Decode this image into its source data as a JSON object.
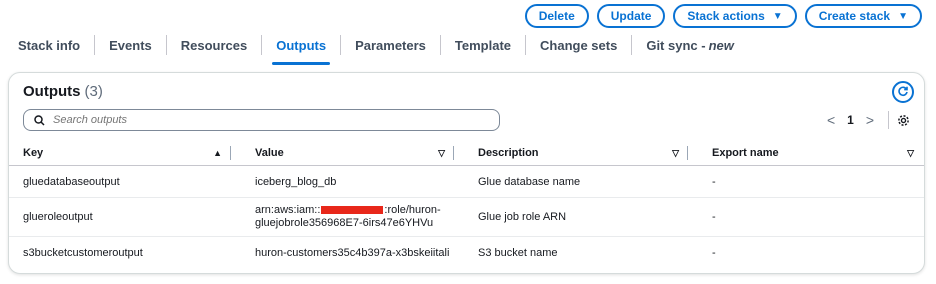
{
  "actions": {
    "delete": "Delete",
    "update": "Update",
    "stack_actions": "Stack actions",
    "create_stack": "Create stack"
  },
  "tabs": [
    {
      "label": "Stack info"
    },
    {
      "label": "Events"
    },
    {
      "label": "Resources"
    },
    {
      "label": "Outputs",
      "active": true
    },
    {
      "label": "Parameters"
    },
    {
      "label": "Template"
    },
    {
      "label": "Change sets"
    },
    {
      "label": "Git sync -",
      "badge": "new"
    }
  ],
  "panel": {
    "title": "Outputs",
    "count": "(3)",
    "search_placeholder": "Search outputs",
    "page": "1"
  },
  "table": {
    "columns": [
      "Key",
      "Value",
      "Description",
      "Export name"
    ],
    "rows": [
      {
        "key": "gluedatabaseoutput",
        "value": "iceberg_blog_db",
        "description": "Glue database name",
        "export": "-"
      },
      {
        "key": "glueroleoutput",
        "value_prefix": "arn:aws:iam::",
        "value_suffix": ":role/huron-",
        "value_line2": "gluejobrole356968E7-6irs47e6YHVu",
        "description": "Glue job role ARN",
        "export": "-"
      },
      {
        "key": "s3bucketcustomeroutput",
        "value": "huron-customers35c4b397a-x3bskeiitali",
        "description": "S3 bucket name",
        "export": "-"
      }
    ]
  },
  "colors": {
    "accent": "#0972d3",
    "redaction": "#e8271a"
  }
}
